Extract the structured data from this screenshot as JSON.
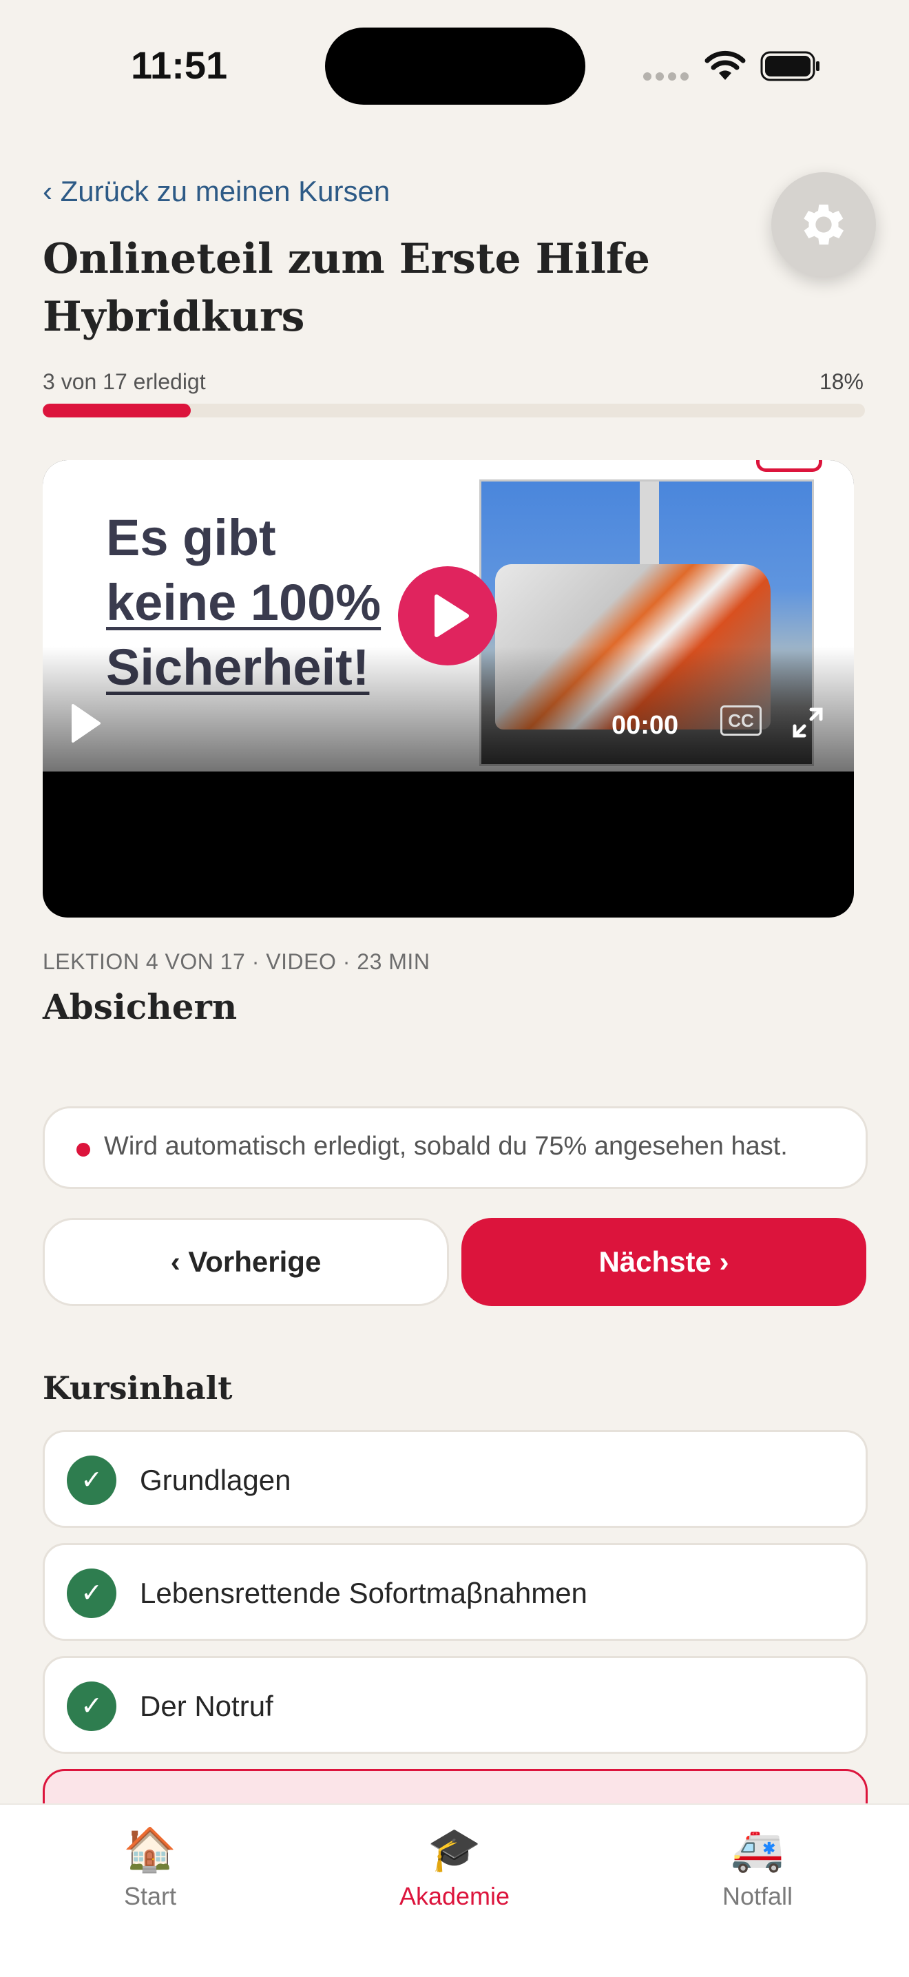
{
  "status_bar": {
    "time": "11:51"
  },
  "header": {
    "back_link": "‹ Zurück zu meinen Kursen",
    "title": "Onlineteil zum Erste Hilfe Hybridkurs",
    "progress_text": "3 von 17 erledigt",
    "progress_percent_label": "18%",
    "progress_value": 0.18
  },
  "video": {
    "slide_line1": "Es gibt",
    "slide_line2": "keine 100%",
    "slide_line3": "Sicherheit!",
    "time": "00:00",
    "cc_label": "CC"
  },
  "lesson": {
    "meta": "LEKTION 4 VON 17 · VIDEO · 23 MIN",
    "title": "Absichern",
    "info": "Wird automatisch erledigt, sobald du 75% angesehen hast."
  },
  "nav": {
    "prev_label": "‹ Vorherige",
    "next_label": "Nächste ›"
  },
  "course_content": {
    "title": "Kursinhalt",
    "items": [
      {
        "label": "Grundlagen",
        "done": true
      },
      {
        "label": "Lebensrettende Sofortmaβnahmen",
        "done": true
      },
      {
        "label": "Der Notruf",
        "done": true
      }
    ]
  },
  "tabbar": {
    "items": [
      {
        "label": "Start",
        "icon": "house-icon",
        "glyph": "🏠"
      },
      {
        "label": "Akademie",
        "icon": "graduation-cap-icon",
        "glyph": "🎓"
      },
      {
        "label": "Notfall",
        "icon": "ambulance-icon",
        "glyph": "🚑"
      }
    ],
    "active": "Akademie"
  },
  "colors": {
    "accent": "#dc143c",
    "check": "#2e7d4f",
    "link": "#2d5a86",
    "background": "#f5f2ed"
  }
}
